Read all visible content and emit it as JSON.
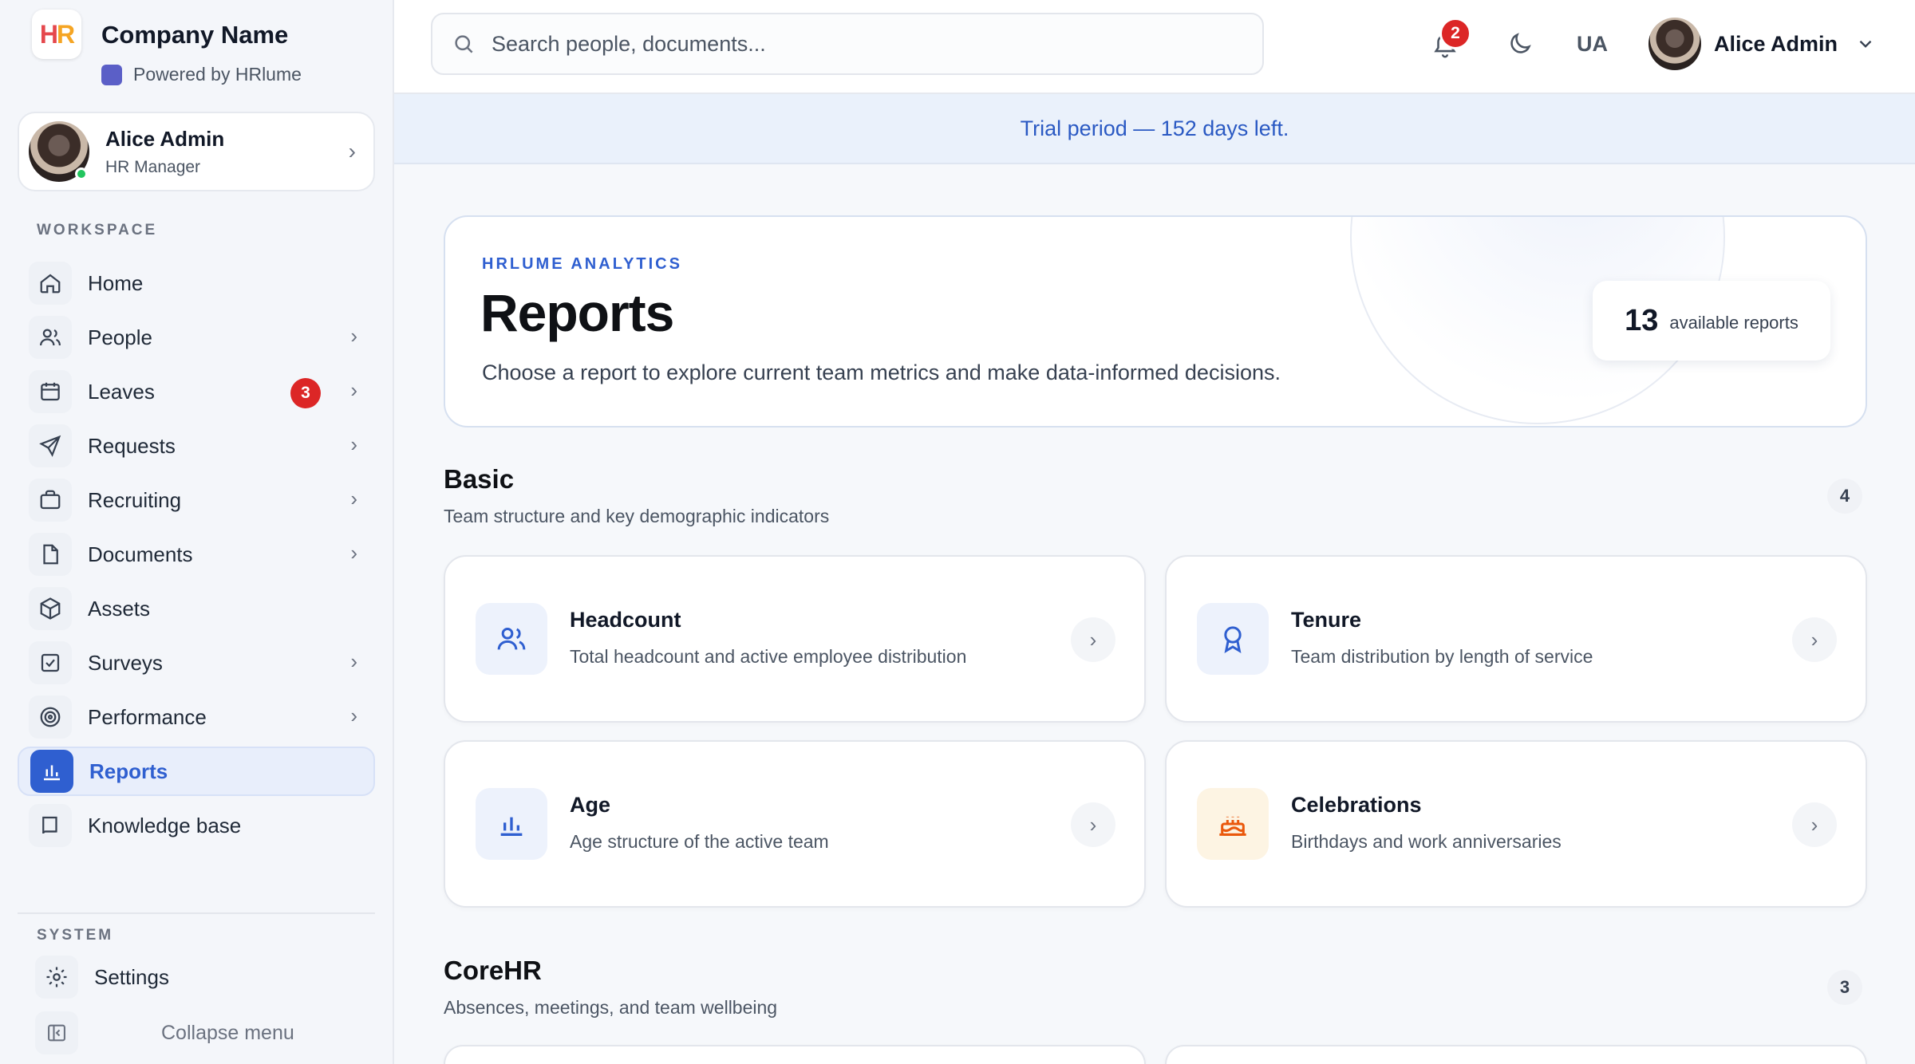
{
  "brand": {
    "name": "Company Name",
    "powered_by": "Powered by HRlume",
    "logo_h": "H",
    "logo_r": "R"
  },
  "user": {
    "name": "Alice Admin",
    "role": "HR Manager"
  },
  "sidebar": {
    "workspace_label": "WORKSPACE",
    "items": [
      {
        "label": "Home",
        "icon": "home-icon"
      },
      {
        "label": "People",
        "icon": "people-icon"
      },
      {
        "label": "Leaves",
        "icon": "calendar-icon",
        "badge": "3"
      },
      {
        "label": "Requests",
        "icon": "send-icon"
      },
      {
        "label": "Recruiting",
        "icon": "briefcase-icon"
      },
      {
        "label": "Documents",
        "icon": "document-icon"
      },
      {
        "label": "Assets",
        "icon": "box-icon"
      },
      {
        "label": "Surveys",
        "icon": "checkbox-icon"
      },
      {
        "label": "Performance",
        "icon": "target-icon"
      },
      {
        "label": "Reports",
        "icon": "bar-chart-icon",
        "active": true
      },
      {
        "label": "Knowledge base",
        "icon": "book-icon"
      }
    ],
    "system_label": "SYSTEM",
    "settings_label": "Settings",
    "collapse_label": "Collapse menu"
  },
  "topbar": {
    "search_placeholder": "Search people, documents...",
    "notification_count": "2",
    "language": "UA",
    "user_name": "Alice Admin"
  },
  "trial_banner": "Trial period — 152 days left.",
  "hero": {
    "eyebrow": "HRLUME ANALYTICS",
    "title": "Reports",
    "subtitle": "Choose a report to explore current team metrics and make data-informed decisions.",
    "count": "13",
    "count_label": "available reports"
  },
  "sections": [
    {
      "title": "Basic",
      "subtitle": "Team structure and key demographic indicators",
      "count": "4",
      "cards": [
        {
          "title": "Headcount",
          "subtitle": "Total headcount and active employee distribution",
          "icon": "people-icon"
        },
        {
          "title": "Tenure",
          "subtitle": "Team distribution by length of service",
          "icon": "award-icon"
        },
        {
          "title": "Age",
          "subtitle": "Age structure of the active team",
          "icon": "bar-chart-icon"
        },
        {
          "title": "Celebrations",
          "subtitle": "Birthdays and work anniversaries",
          "icon": "cake-icon"
        }
      ]
    },
    {
      "title": "CoreHR",
      "subtitle": "Absences, meetings, and team wellbeing",
      "count": "3"
    }
  ],
  "colors": {
    "accent": "#2f5fd0",
    "badge": "#dc2626",
    "trial_bg": "#eaf1fb"
  }
}
